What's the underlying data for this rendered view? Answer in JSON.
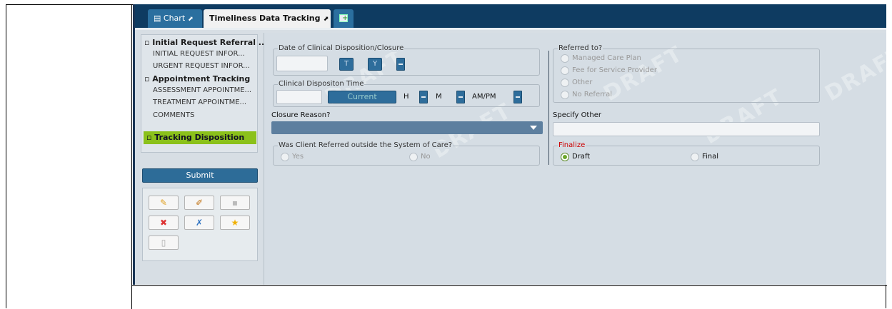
{
  "tabs": {
    "chart": "Chart",
    "tracking": "Timeliness Data Tracking",
    "pin_glyph": "⬈",
    "add_icon": "add-tab-icon"
  },
  "nav": {
    "items": [
      "▫ Initial Request Referral ...",
      "INITIAL REQUEST INFOR...",
      "URGENT REQUEST INFOR...",
      "▫ Appointment Tracking",
      "ASSESSMENT APPOINTME...",
      "TREATMENT APPOINTME...",
      "COMMENTS"
    ],
    "active": "▫ Tracking Disposition"
  },
  "submit_label": "Submit",
  "form": {
    "date_group": "Date of Clinical Disposition/Closure",
    "t_button": "T",
    "y_button": "Y",
    "time_group": "Clinical Dispositon Time",
    "current_button": "Current",
    "h_label": "H",
    "m_label": "M",
    "ampm_label": "AM/PM",
    "closure_reason": "Closure Reason?",
    "referred_outside_group": "Was Client Referred outside the System of Care?",
    "yes": "Yes",
    "no": "No",
    "referred_to_group": "Referred to?",
    "referred_options": [
      "Managed Care Plan",
      "Fee for Service Provider",
      "Other",
      "No Referral"
    ],
    "specify_other": "Specify Other",
    "finalize_group": "Finalize",
    "draft": "Draft",
    "final": "Final",
    "finalize_selected": "Draft"
  },
  "watermark": "DRAFT",
  "colors": {
    "accent": "#0e3b61",
    "active_nav": "#8bc11a",
    "required": "#cc0000"
  }
}
